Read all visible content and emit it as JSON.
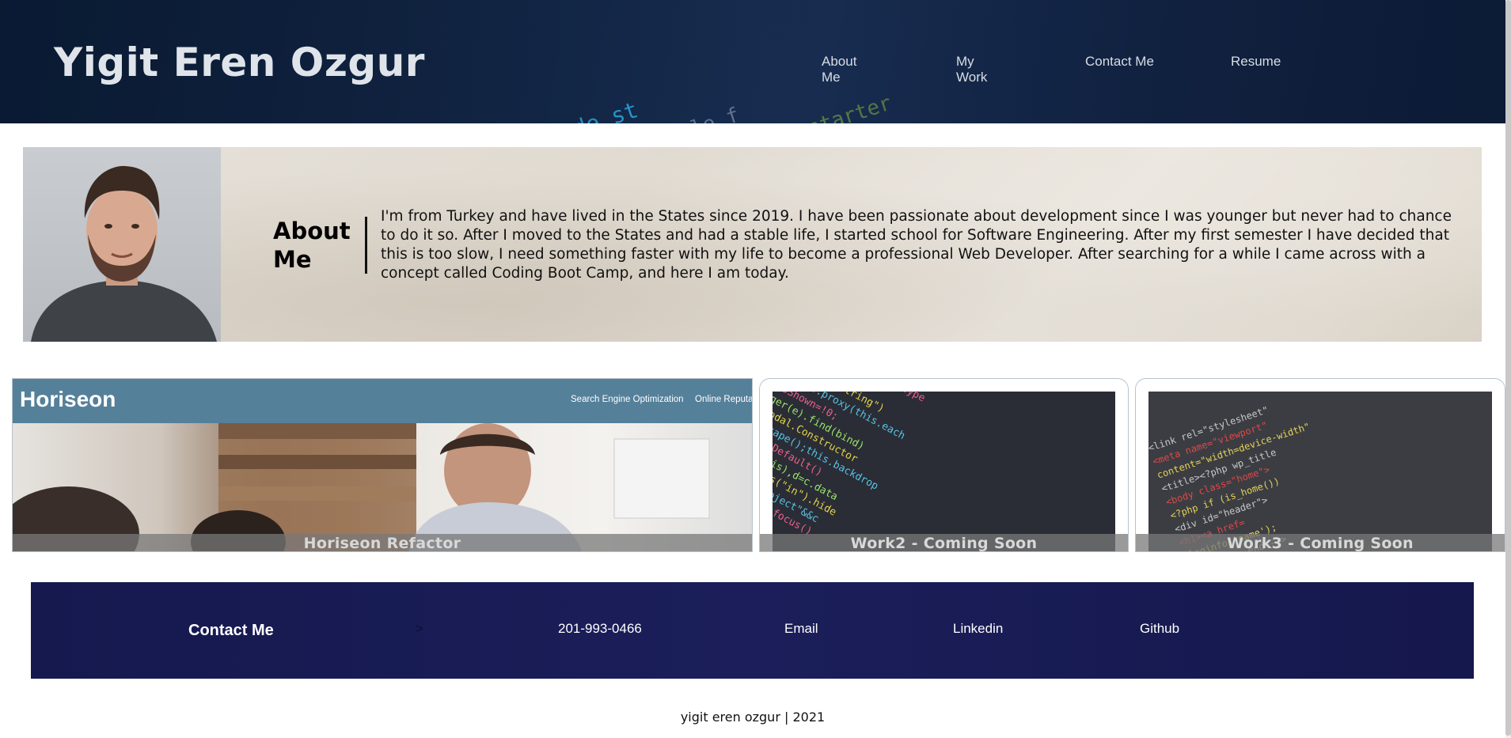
{
  "header": {
    "title": "Yigit Eren Ozgur",
    "nav": [
      "About Me",
      "My Work",
      "Contact Me",
      "Resume"
    ]
  },
  "about": {
    "heading": "About Me",
    "text": "I'm from Turkey and have lived in the States since 2019. I have been passionate about development since I was younger but never had to chance to do it so. After I moved to the States and had a stable life, I started school for Software Engineering. After my first semester I have decided that this is too slow, I need something faster with my life to become a professional Web Developer. After searching for a while I came across with a concept called Coding Boot Camp, and here I am today."
  },
  "works": [
    {
      "label": "Horiseon Refactor",
      "preview": {
        "logo": "Horiseon",
        "nav": [
          "Search Engine Optimization",
          "Online Reputa"
        ]
      }
    },
    {
      "label": "Work2 - Coming Soon"
    },
    {
      "label": "Work3 - Coming Soon"
    }
  ],
  "contact": {
    "title": "Contact Me",
    "arrow": ">",
    "phone": "201-993-0466",
    "email": "Email",
    "linkedin": "Linkedin",
    "github": "Github"
  },
  "footer": {
    "text": "yigit eren ozgur | 2021"
  }
}
